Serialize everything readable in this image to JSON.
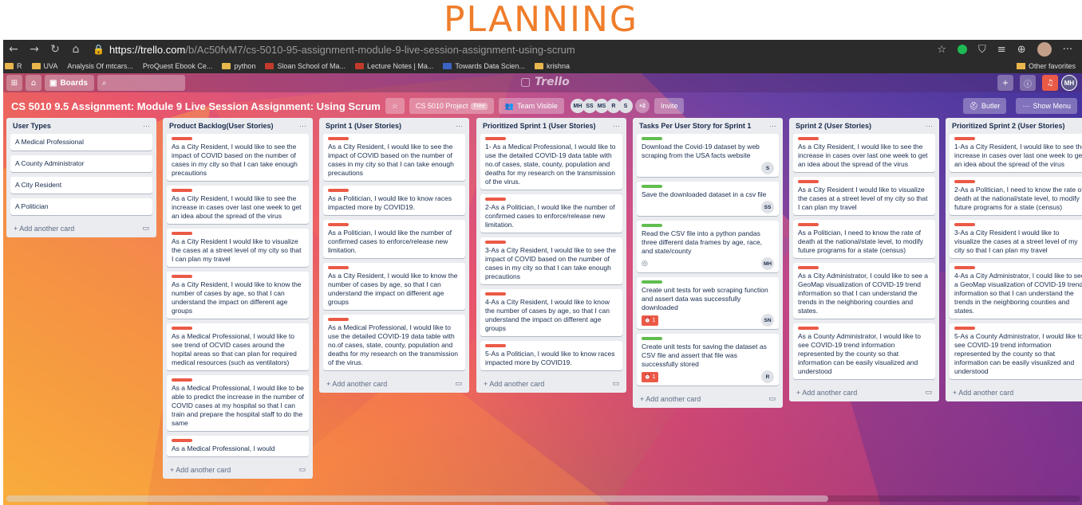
{
  "slide_title": "PLANNING",
  "browser": {
    "url_host": "https://trello.com",
    "url_path": "/b/Ac50fvM7/cs-5010-95-assignment-module-9-live-session-assignment-using-scrum",
    "bookmarks": [
      {
        "label": "R",
        "icon": "folder"
      },
      {
        "label": "UVA",
        "icon": "folder"
      },
      {
        "label": "Analysis Of mtcars...",
        "icon": "page"
      },
      {
        "label": "ProQuest Ebook Ce...",
        "icon": "page"
      },
      {
        "label": "python",
        "icon": "folder"
      },
      {
        "label": "Sloan School of Ma...",
        "icon": "red"
      },
      {
        "label": "Lecture Notes | Ma...",
        "icon": "red"
      },
      {
        "label": "Towards Data Scien...",
        "icon": "blue"
      },
      {
        "label": "krishna",
        "icon": "folder"
      }
    ],
    "other_favorites": "Other favorites"
  },
  "topbar": {
    "boards_label": "Boards",
    "logo": "Trello",
    "user_initials": "MH"
  },
  "board": {
    "title": "CS 5010 9.5 Assignment: Module 9 Live Session Assignment: Using Scrum",
    "team": "CS 5010 Project",
    "team_badge": "Free",
    "visibility": "Team Visible",
    "members": [
      "MH",
      "SS",
      "MS",
      "R",
      "S"
    ],
    "extra_members": "+2",
    "invite": "Invite",
    "butler": "Butler",
    "show_menu": "Show Menu"
  },
  "add_card_label": "+ Add another card",
  "lists": [
    {
      "title": "User Types",
      "cards": [
        {
          "text": "A Medical Professional"
        },
        {
          "text": "A County Administrator"
        },
        {
          "text": "A City Resident"
        },
        {
          "text": "A Politician"
        }
      ]
    },
    {
      "title": "Product Backlog(User Stories)",
      "cards": [
        {
          "label": "red",
          "text": "As a City Resident, I would like to see the impact of COVID based on the number of cases in my city so that I can take enough precautions"
        },
        {
          "label": "red",
          "text": "As a City Resident, I would like to see the increase in cases over last one week to get an idea about the spread of the virus"
        },
        {
          "label": "red",
          "text": "As a City Resident I would like to visualize the cases at a street level of my city so that I can plan my travel"
        },
        {
          "label": "red",
          "text": "As a City Resident, I would like to know the number of cases by age, so that I can understand the impact on different age groups"
        },
        {
          "label": "red",
          "text": "As a Medical Professional, I would like to see trend of OCVID cases around the hopital areas so that can plan for required medical resources (such as ventilators)"
        },
        {
          "label": "red",
          "text": "As a Medical Professional, I would like to be able to predict the increase in the number of COVID cases at my hospital so that I can train and prepare the hospital staff to do the same"
        },
        {
          "label": "red",
          "text": "As a Medical Professional, I would"
        }
      ]
    },
    {
      "title": "Sprint 1 (User Stories)",
      "cards": [
        {
          "label": "red",
          "text": "As a City Resident, I would like to see the impact of COVID based on the number of cases in my city so that I can take enough precautions"
        },
        {
          "label": "red",
          "text": "As a Politician, I would like to know races impacted more by COVID19."
        },
        {
          "label": "red",
          "text": "As a Politician, I would like the number of confirmed cases to enforce/release new limitation."
        },
        {
          "label": "red",
          "text": "As a City Resident, I would like to know the number of cases by age, so that I can understand the impact on different age groups"
        },
        {
          "label": "red",
          "text": "As a Medical Professional, I would like to use the detailed COVID-19 data table with no.of cases, state, county, population and deaths for my research on the transmission of the virus."
        }
      ]
    },
    {
      "title": "Prioritized Sprint 1 (User Stories)",
      "cards": [
        {
          "label": "red",
          "text": "1- As a Medical Professional, I would like to use the detailed COVID-19 data table with no.of cases, state, county, population and deaths for my research on the transmission of the virus."
        },
        {
          "label": "red",
          "text": "2-As a Politician, I would like the number of confirmed cases to enforce/release new limitation."
        },
        {
          "label": "red",
          "text": "3-As a City Resident, I would like to see the impact of COVID based on the number of cases in my city so that I can take enough precautions"
        },
        {
          "label": "red",
          "text": "4-As a City Resident, I would like to know the number of cases by age, so that I can understand the impact on different age groups"
        },
        {
          "label": "red",
          "text": "5-As a Politician, I would like to know races impacted more by COVID19."
        }
      ]
    },
    {
      "title": "Tasks Per User Story for Sprint 1",
      "cards": [
        {
          "label": "green",
          "text": "Download the Covid-19 dataset by web scraping from the USA facts website",
          "member": "S"
        },
        {
          "label": "green",
          "text": "Save the downloaded dataset in a csv file",
          "member": "SS"
        },
        {
          "label": "green",
          "text": "Read the CSV file into a python pandas three different data frames by age, race, and state/county",
          "member": "MH",
          "watch": true
        },
        {
          "label": "green",
          "text": "Create unit tests for web scraping function and assert data was successfully downloaded",
          "member": "SN",
          "due": "1"
        },
        {
          "label": "green",
          "text": "Create unit tests for saving the dataset as CSV file and assert that file was successfully stored",
          "member": "R",
          "due": "1"
        }
      ]
    },
    {
      "title": "Sprint 2 (User Stories)",
      "cards": [
        {
          "label": "red",
          "text": "As a City Resident, I would like to see the increase in cases over last one week to get an idea about the spread of the virus"
        },
        {
          "label": "red",
          "text": "As a City Resident I would like to visualize the cases at a street level of my city so that I can plan my travel"
        },
        {
          "label": "red",
          "text": "As a Politician, I need to know the rate of death at the national/state level, to modify future programs for a state (census)"
        },
        {
          "label": "red",
          "text": "As a City Administrator, I could like to see a GeoMap visualization of COVID-19 trend information so that I can understand the trends in the neighboring counties and states."
        },
        {
          "label": "red",
          "text": "As a County Administrator, I would like to see COVID-19 trend information represented by the county so that information can be easily visualized and understood"
        }
      ]
    },
    {
      "title": "Prioritized Sprint 2 (User Stories)",
      "cards": [
        {
          "label": "red",
          "text": "1-As a City Resident, I would like to see the increase in cases over last one week to get an idea about the spread of the virus"
        },
        {
          "label": "red",
          "text": "2-As a Politician, I need to know the rate of death at the national/state level, to modify future programs for a state (census)"
        },
        {
          "label": "red",
          "text": "3-As a City Resident I would like to visualize the cases at a street level of my city so that I can plan my travel"
        },
        {
          "label": "red",
          "text": "4-As a City Administrator, I could like to see a GeoMap visualization of COVID-19 trend information so that I can understand the trends in the neighboring counties and states."
        },
        {
          "label": "red",
          "text": "5-As a County Administrator, I would like to see COVID-19 trend information represented by the county so that information can be easily visualized and understood"
        }
      ]
    }
  ]
}
